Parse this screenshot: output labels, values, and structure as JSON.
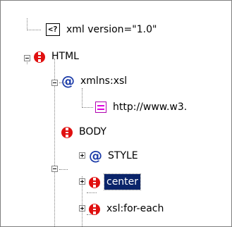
{
  "tree": {
    "nodes": [
      {
        "id": "pi",
        "label": "xml version=\"1.0\"",
        "icon": "processing-instruction-icon",
        "pi_glyph": "<?"
      },
      {
        "id": "html",
        "label": "HTML",
        "icon": "element-icon"
      },
      {
        "id": "xmlns",
        "label": "xmlns:xsl",
        "icon": "attribute-icon",
        "attr_glyph": "@"
      },
      {
        "id": "url",
        "label": "http://www.w3.",
        "icon": "text-node-icon"
      },
      {
        "id": "body",
        "label": "BODY",
        "icon": "element-icon"
      },
      {
        "id": "style",
        "label": "STYLE",
        "icon": "attribute-icon",
        "attr_glyph": "@"
      },
      {
        "id": "center",
        "label": "center",
        "icon": "element-icon",
        "selected": true
      },
      {
        "id": "foreach",
        "label": "xsl:for-each",
        "icon": "element-icon"
      }
    ]
  },
  "colors": {
    "element_icon": "#e01010",
    "attribute_icon": "#1a3aa8",
    "text_icon": "#e000e0",
    "selection_bg": "#0a246a",
    "selection_fg": "#ffffff"
  }
}
